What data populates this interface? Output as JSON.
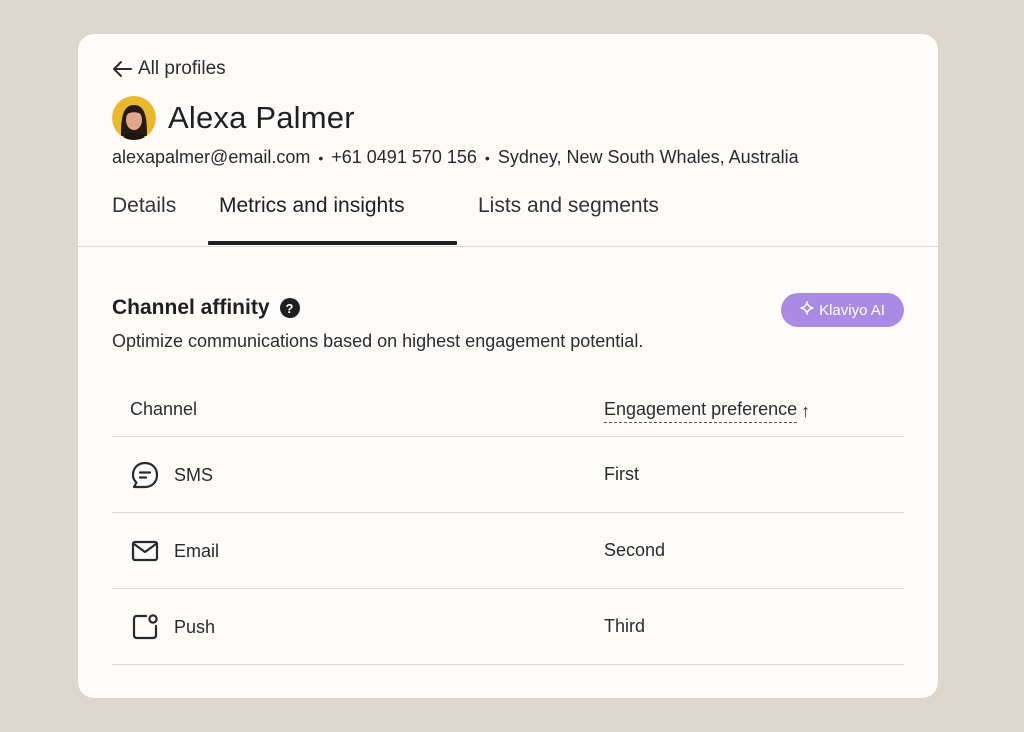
{
  "nav": {
    "back_label": "All profiles"
  },
  "profile": {
    "name": "Alexa Palmer",
    "email": "alexapalmer@email.com",
    "phone": "+61 0491 570 156",
    "location": "Sydney, New South Whales, Australia",
    "separator": "•"
  },
  "tabs": [
    {
      "label": "Details",
      "active": false
    },
    {
      "label": "Metrics and insights",
      "active": true
    },
    {
      "label": "Lists and segments",
      "active": false
    }
  ],
  "channel_affinity": {
    "title": "Channel affinity",
    "help_glyph": "?",
    "description": "Optimize communications based on highest engagement potential.",
    "ai_badge": {
      "label": "Klaviyo AI",
      "icon": "sparkle-icon",
      "color": "#a98be6"
    },
    "table": {
      "headers": {
        "channel": "Channel",
        "preference": "Engagement preference",
        "sort_glyph": "↑"
      },
      "rows": [
        {
          "channel": "SMS",
          "icon": "chat-bubble-icon",
          "preference": "First"
        },
        {
          "channel": "Email",
          "icon": "mail-icon",
          "preference": "Second"
        },
        {
          "channel": "Push",
          "icon": "push-notification-icon",
          "preference": "Third"
        }
      ]
    }
  },
  "colors": {
    "background": "#ddd7cf",
    "card": "#fdfcfa",
    "text": "#232323",
    "accent": "#a98be6",
    "divider": "#dcdad6"
  }
}
